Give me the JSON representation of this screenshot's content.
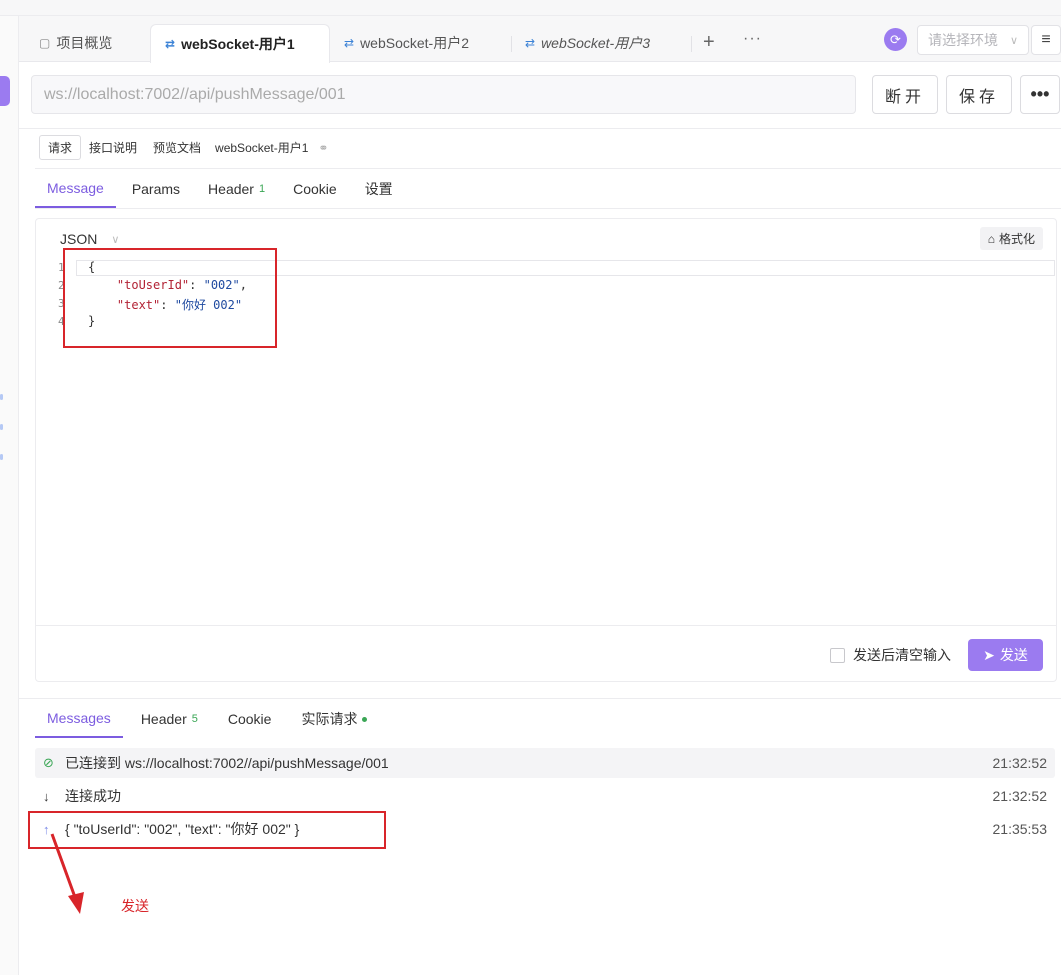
{
  "tabs": [
    {
      "label": "项目概览",
      "icon": "overview-icon"
    },
    {
      "label": "webSocket-用户1",
      "icon": "websocket-icon"
    },
    {
      "label": "webSocket-用户2",
      "icon": "websocket-icon"
    },
    {
      "label": "webSocket-用户3",
      "icon": "websocket-icon"
    }
  ],
  "header": {
    "plus": "+",
    "more": "···",
    "env_placeholder": "请选择环境",
    "menu": "≡"
  },
  "url": {
    "value": "ws://localhost:7002//api/pushMessage/001",
    "disconnect_label": "断开",
    "save_label": "保存",
    "more_label": "•••"
  },
  "subtabs": {
    "items": [
      "请求",
      "接口说明",
      "预览文档"
    ],
    "title": "webSocket-用户1"
  },
  "main_tabs": [
    {
      "label": "Message"
    },
    {
      "label": "Params"
    },
    {
      "label": "Header",
      "badge": "1"
    },
    {
      "label": "Cookie"
    },
    {
      "label": "设置"
    }
  ],
  "editor": {
    "format": "JSON",
    "format_button": "格式化",
    "gutter": [
      "1",
      "2",
      "3",
      "4"
    ],
    "lines": {
      "l1": "{",
      "l2_key": "\"toUserId\"",
      "l2_val": "\"002\"",
      "l3_key": "\"text\"",
      "l3_val": "\"你好 002\"",
      "l4": "}"
    },
    "clear_after_send": "发送后清空输入",
    "send_label": "发送"
  },
  "message_tabs": [
    {
      "label": "Messages"
    },
    {
      "label": "Header",
      "badge": "5"
    },
    {
      "label": "Cookie"
    },
    {
      "label": "实际请求"
    }
  ],
  "messages": [
    {
      "type": "connected",
      "icon": "check-circle-icon",
      "text": "已连接到 ws://localhost:7002//api/pushMessage/001",
      "time": "21:32:52"
    },
    {
      "type": "received",
      "icon": "arrow-down-icon",
      "text": "连接成功",
      "time": "21:32:52"
    },
    {
      "type": "sent",
      "icon": "arrow-up-icon",
      "text": "{ \"toUserId\": \"002\", \"text\": \"你好 002\" }",
      "time": "21:35:53"
    }
  ],
  "annotation": {
    "label": "发送",
    "color": "#d8252a"
  },
  "colors": {
    "accent": "#9b7bf0",
    "tab_active": "#7c5ce0",
    "badge_green": "#3aa655"
  }
}
